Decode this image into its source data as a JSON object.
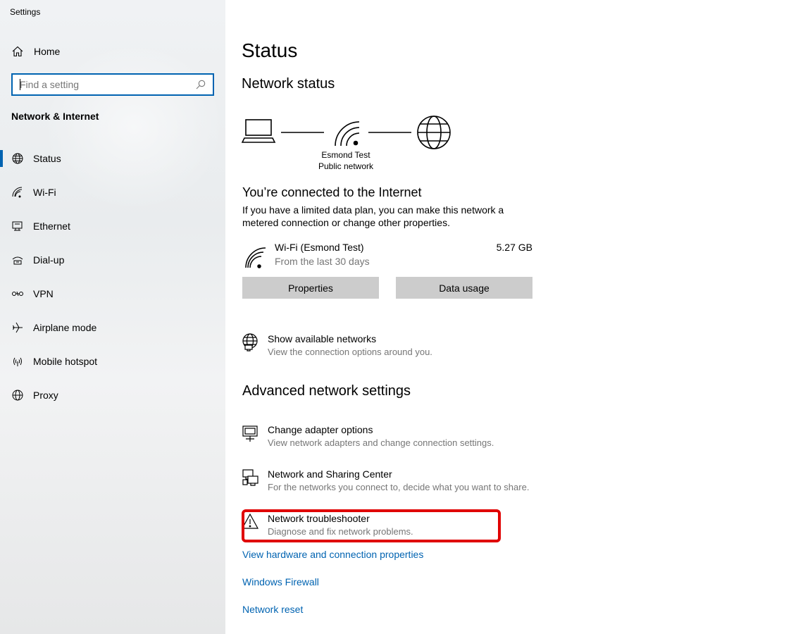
{
  "app": {
    "title": "Settings"
  },
  "sidebar": {
    "home": {
      "label": "Home",
      "icon": "home-icon"
    },
    "search": {
      "placeholder": "Find a setting",
      "icon": "search-icon"
    },
    "section_title": "Network & Internet",
    "items": [
      {
        "label": "Status",
        "icon": "globe-status-icon",
        "active": true
      },
      {
        "label": "Wi-Fi",
        "icon": "wifi-icon"
      },
      {
        "label": "Ethernet",
        "icon": "ethernet-icon"
      },
      {
        "label": "Dial-up",
        "icon": "dialup-icon"
      },
      {
        "label": "VPN",
        "icon": "vpn-icon"
      },
      {
        "label": "Airplane mode",
        "icon": "airplane-icon"
      },
      {
        "label": "Mobile hotspot",
        "icon": "hotspot-icon"
      },
      {
        "label": "Proxy",
        "icon": "globe-icon"
      }
    ]
  },
  "main": {
    "title": "Status",
    "network_status_heading": "Network status",
    "diagram": {
      "network_name": "Esmond Test",
      "network_type": "Public network"
    },
    "connected_heading": "You’re connected to the Internet",
    "connected_desc": "If you have a limited data plan, you can make this network a metered connection or change other properties.",
    "wifi": {
      "name": "Wi-Fi (Esmond Test)",
      "period": "From the last 30 days",
      "usage": "5.27 GB"
    },
    "buttons": {
      "properties": "Properties",
      "data_usage": "Data usage"
    },
    "show_networks": {
      "title": "Show available networks",
      "desc": "View the connection options around you."
    },
    "advanced_heading": "Advanced network settings",
    "advanced_items": [
      {
        "title": "Change adapter options",
        "desc": "View network adapters and change connection settings.",
        "icon": "adapter-icon"
      },
      {
        "title": "Network and Sharing Center",
        "desc": "For the networks you connect to, decide what you want to share.",
        "icon": "sharing-center-icon"
      },
      {
        "title": "Network troubleshooter",
        "desc": "Diagnose and fix network problems.",
        "icon": "warning-icon"
      }
    ],
    "links": {
      "hardware": "View hardware and connection properties",
      "firewall": "Windows Firewall",
      "reset": "Network reset"
    },
    "accent_color": "#0063b1",
    "highlight_color": "#e00000"
  }
}
